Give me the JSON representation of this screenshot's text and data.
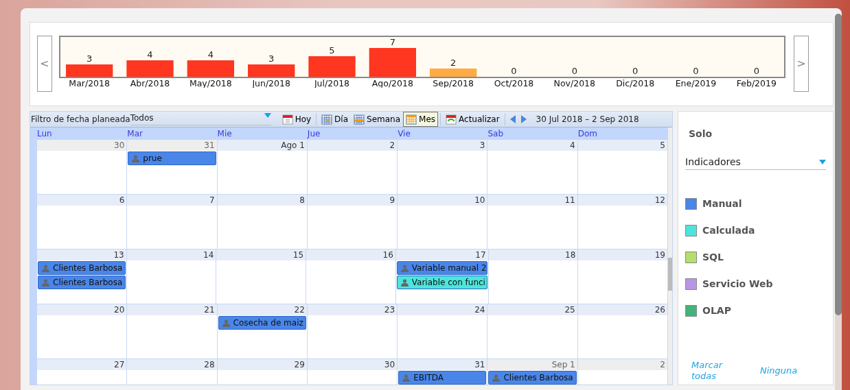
{
  "chart_panel": {
    "prev_button": "<",
    "next_button": ">",
    "chart_data": {
      "type": "bar",
      "stacked": true,
      "data_labels": true,
      "ylim": [
        0,
        10
      ],
      "categories": [
        "Mar/2018",
        "Abr/2018",
        "May/2018",
        "Jun/2018",
        "Jul/2018",
        "Ago/2018",
        "Sep/2018",
        "Oct/2018",
        "Nov/2018",
        "Dic/2018",
        "Ene/2019",
        "Feb/2019"
      ],
      "series": [
        {
          "color": "#ff3620",
          "values": [
            3,
            4,
            4,
            3,
            5,
            7,
            null,
            0,
            0,
            0,
            0,
            0
          ]
        },
        {
          "color": "#ffab45",
          "values": [
            null,
            null,
            null,
            null,
            null,
            null,
            2,
            null,
            null,
            null,
            null,
            null
          ]
        }
      ]
    }
  },
  "toolbar": {
    "filter_label": "Filtro de fecha planeada",
    "filter_value": "Todos",
    "buttons": [
      {
        "label": "Hoy",
        "kind": "today",
        "selected": false
      },
      {
        "label": "Día",
        "kind": "day",
        "selected": false
      },
      {
        "label": "Semana",
        "kind": "week",
        "selected": false
      },
      {
        "label": "Mes",
        "kind": "month",
        "selected": true
      },
      {
        "label": "Actualizar",
        "kind": "refresh",
        "selected": false
      }
    ],
    "range": "30 Jul 2018 – 2 Sep 2018"
  },
  "calendar": {
    "weekdays": [
      "Lun",
      "Mar",
      "Mie",
      "Jue",
      "Vie",
      "Sab",
      "Dom"
    ],
    "weeks": [
      {
        "days": [
          {
            "label": "30",
            "other_month": true
          },
          {
            "label": "31",
            "other_month": true,
            "events": [
              {
                "title": "prue",
                "color": "#4a86e8"
              }
            ]
          },
          {
            "label": "Ago 1",
            "other_month": false
          },
          {
            "label": "2",
            "other_month": false
          },
          {
            "label": "3",
            "other_month": false
          },
          {
            "label": "4",
            "other_month": false
          },
          {
            "label": "5",
            "other_month": false
          }
        ]
      },
      {
        "days": [
          {
            "label": "6",
            "other_month": false
          },
          {
            "label": "7",
            "other_month": false
          },
          {
            "label": "8",
            "other_month": false
          },
          {
            "label": "9",
            "other_month": false
          },
          {
            "label": "10",
            "other_month": false
          },
          {
            "label": "11",
            "other_month": false
          },
          {
            "label": "12",
            "other_month": false
          }
        ]
      },
      {
        "days": [
          {
            "label": "13",
            "other_month": false,
            "events": [
              {
                "title": "Clientes Barbosa",
                "color": "#4a86e8"
              },
              {
                "title": "Clientes Barbosa",
                "color": "#4a86e8"
              }
            ]
          },
          {
            "label": "14",
            "other_month": false
          },
          {
            "label": "15",
            "other_month": false
          },
          {
            "label": "16",
            "other_month": false
          },
          {
            "label": "17",
            "other_month": false,
            "events": [
              {
                "title": "Variable manual 2",
                "color": "#4a86e8"
              },
              {
                "title": "Variable con funci",
                "color": "#4ee4dc"
              }
            ]
          },
          {
            "label": "18",
            "other_month": false
          },
          {
            "label": "19",
            "other_month": false
          }
        ]
      },
      {
        "days": [
          {
            "label": "20",
            "other_month": false
          },
          {
            "label": "21",
            "other_month": false
          },
          {
            "label": "22",
            "other_month": false,
            "events": [
              {
                "title": "Cosecha de maiz",
                "color": "#4a86e8"
              }
            ]
          },
          {
            "label": "23",
            "other_month": false
          },
          {
            "label": "24",
            "other_month": false
          },
          {
            "label": "25",
            "other_month": false
          },
          {
            "label": "26",
            "other_month": false
          }
        ]
      },
      {
        "days": [
          {
            "label": "27",
            "other_month": false
          },
          {
            "label": "28",
            "other_month": false
          },
          {
            "label": "29",
            "other_month": false
          },
          {
            "label": "30",
            "other_month": false
          },
          {
            "label": "31",
            "other_month": false,
            "events": [
              {
                "title": "EBITDA",
                "color": "#4a86e8"
              }
            ]
          },
          {
            "label": "Sep 1",
            "other_month": true,
            "events": [
              {
                "title": "Clientes Barbosa",
                "color": "#4a86e8"
              }
            ]
          },
          {
            "label": "2",
            "other_month": true
          }
        ]
      }
    ]
  },
  "side_panel": {
    "title": "Solo",
    "select_value": "Indicadores",
    "legend": [
      {
        "label": "Manual",
        "color": "#4a86e8"
      },
      {
        "label": "Calculada",
        "color": "#4ee4dc"
      },
      {
        "label": "SQL",
        "color": "#b5de6c"
      },
      {
        "label": "Servicio Web",
        "color": "#b896e6"
      },
      {
        "label": "OLAP",
        "color": "#43b37b"
      }
    ],
    "links": [
      "Marcar todas",
      "Ninguna"
    ]
  }
}
